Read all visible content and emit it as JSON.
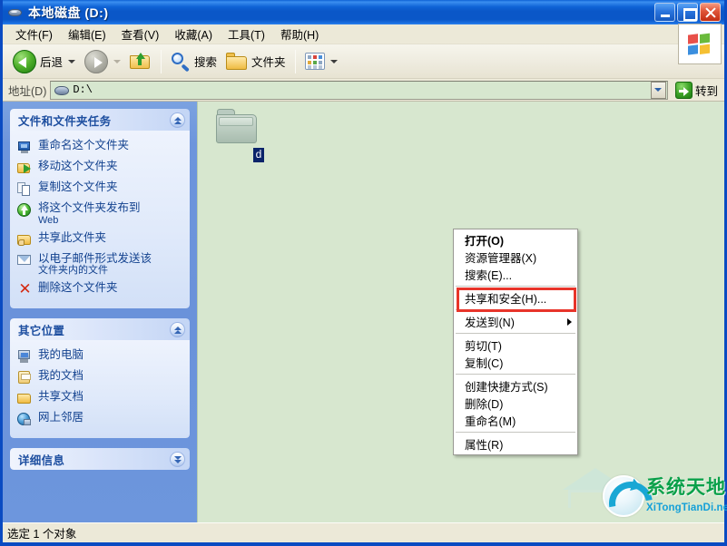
{
  "window": {
    "title": "本地磁盘 (D:)",
    "icon": "hard-disk-icon",
    "controls": {
      "minimize": "最小化",
      "maximize": "最大化",
      "close": "关闭"
    }
  },
  "menubar": {
    "items": [
      {
        "label": "文件(F)"
      },
      {
        "label": "编辑(E)"
      },
      {
        "label": "查看(V)"
      },
      {
        "label": "收藏(A)"
      },
      {
        "label": "工具(T)"
      },
      {
        "label": "帮助(H)"
      }
    ],
    "logo": "windows-flag-logo"
  },
  "toolbar": {
    "back": "后退",
    "forward": "",
    "up": "",
    "search": "搜索",
    "folders": "文件夹",
    "views": ""
  },
  "address": {
    "label": "地址(D)",
    "value": "D:\\",
    "go_label": "转到"
  },
  "sidebar": {
    "panels": [
      {
        "title": "文件和文件夹任务",
        "state": "expanded",
        "items": [
          {
            "label": "重命名这个文件夹",
            "icon": "rename-icon"
          },
          {
            "label": "移动这个文件夹",
            "icon": "move-icon"
          },
          {
            "label": "复制这个文件夹",
            "icon": "copy-icon"
          },
          {
            "label": "将这个文件夹发布到",
            "sub": "Web",
            "icon": "publish-web-icon"
          },
          {
            "label": "共享此文件夹",
            "icon": "share-folder-icon"
          },
          {
            "label": "以电子邮件形式发送该",
            "sub": "文件夹内的文件",
            "icon": "email-icon"
          },
          {
            "label": "删除这个文件夹",
            "icon": "delete-icon"
          }
        ]
      },
      {
        "title": "其它位置",
        "state": "expanded",
        "items": [
          {
            "label": "我的电脑",
            "icon": "my-computer-icon"
          },
          {
            "label": "我的文档",
            "icon": "my-documents-icon"
          },
          {
            "label": "共享文档",
            "icon": "shared-documents-icon"
          },
          {
            "label": "网上邻居",
            "icon": "network-places-icon"
          }
        ]
      },
      {
        "title": "详细信息",
        "state": "collapsed",
        "items": []
      }
    ]
  },
  "content": {
    "folder": {
      "name": "d",
      "icon": "folder-icon",
      "selected": true
    }
  },
  "context_menu": {
    "items": [
      {
        "label": "打开(O)",
        "bold": true,
        "type": "item"
      },
      {
        "label": "资源管理器(X)",
        "type": "item"
      },
      {
        "label": "搜索(E)...",
        "type": "item"
      },
      {
        "type": "separator"
      },
      {
        "label": "共享和安全(H)...",
        "type": "item",
        "highlighted": true
      },
      {
        "type": "separator"
      },
      {
        "label": "发送到(N)",
        "type": "submenu"
      },
      {
        "type": "separator"
      },
      {
        "label": "剪切(T)",
        "type": "item"
      },
      {
        "label": "复制(C)",
        "type": "item"
      },
      {
        "type": "separator"
      },
      {
        "label": "创建快捷方式(S)",
        "type": "item"
      },
      {
        "label": "删除(D)",
        "type": "item"
      },
      {
        "label": "重命名(M)",
        "type": "item"
      },
      {
        "type": "separator"
      },
      {
        "label": "属性(R)",
        "type": "item"
      }
    ],
    "highlight_color": "#e8342a"
  },
  "statusbar": {
    "text": "选定 1 个对象"
  },
  "watermark": {
    "cn": "系统天地",
    "en": "XiTongTianDi.net",
    "accent_cn": "#0aa04a",
    "accent_en": "#15a0d8"
  },
  "colors": {
    "titlebar": "#0a57c8",
    "toolbar_bg": "#ece9d8",
    "sidebar_bg": "#6a92da",
    "content_bg": "#d7e7cf",
    "panel_title": "#1e4fa0",
    "task_link": "#12418e"
  }
}
